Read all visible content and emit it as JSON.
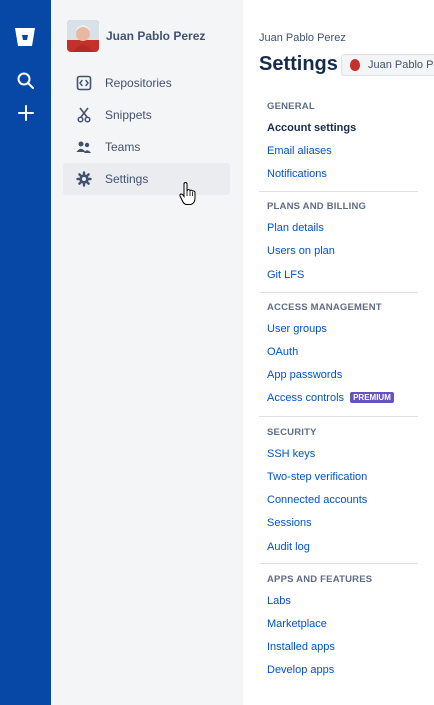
{
  "sidebar": {
    "user_name": "Juan Pablo Perez",
    "items": [
      {
        "label": "Repositories",
        "icon": "repositories-icon"
      },
      {
        "label": "Snippets",
        "icon": "snippets-icon"
      },
      {
        "label": "Teams",
        "icon": "teams-icon"
      },
      {
        "label": "Settings",
        "icon": "gear-icon",
        "active": true
      }
    ]
  },
  "main": {
    "breadcrumb": "Juan Pablo Perez",
    "title": "Settings",
    "account_selector": "Juan Pablo Perez",
    "groups": [
      {
        "heading": "GENERAL",
        "links": [
          "Account settings",
          "Email aliases",
          "Notifications"
        ]
      },
      {
        "heading": "PLANS AND BILLING",
        "links": [
          "Plan details",
          "Users on plan",
          "Git LFS"
        ]
      },
      {
        "heading": "ACCESS MANAGEMENT",
        "links": [
          "User groups",
          "OAuth",
          "App passwords",
          "Access controls"
        ],
        "badge": "PREMIUM"
      },
      {
        "heading": "SECURITY",
        "links": [
          "SSH keys",
          "Two-step verification",
          "Connected accounts",
          "Sessions",
          "Audit log"
        ]
      },
      {
        "heading": "APPS AND FEATURES",
        "links": [
          "Labs",
          "Marketplace",
          "Installed apps",
          "Develop apps"
        ]
      }
    ]
  },
  "colors": {
    "nav_rail": "#0747a6",
    "sidebar_bg": "#f4f5f7",
    "link": "#0052cc",
    "premium_badge": "#6554c0"
  }
}
